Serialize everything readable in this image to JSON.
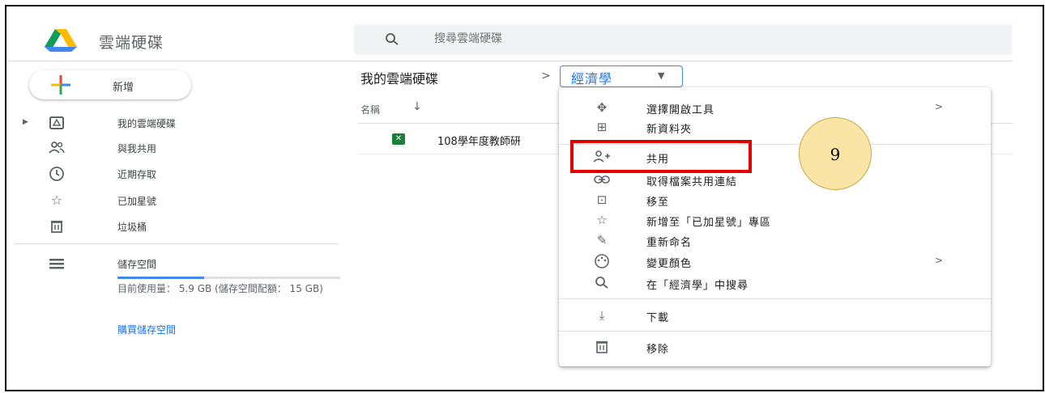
{
  "header": {
    "app_title": "雲端硬碟",
    "search_placeholder": "搜尋雲端硬碟"
  },
  "new_button": {
    "label": "新增"
  },
  "sidebar": {
    "items": [
      {
        "label": "我的雲端硬碟",
        "icon": "drive-icon"
      },
      {
        "label": "與我共用",
        "icon": "shared-people-icon"
      },
      {
        "label": "近期存取",
        "icon": "clock-icon"
      },
      {
        "label": "已加星號",
        "icon": "star-icon"
      },
      {
        "label": "垃圾桶",
        "icon": "trash-icon"
      }
    ],
    "storage": {
      "label": "儲存空間",
      "usage_text": "目前使用量： 5.9 GB (儲存空間配額： 15 GB)",
      "usage_fraction": 0.39,
      "buy_link": "購買儲存空間"
    }
  },
  "breadcrumb": {
    "root": "我的雲端硬碟",
    "separator": ">",
    "current": "經濟學"
  },
  "file_list": {
    "column_name": "名稱",
    "sort_direction": "↓",
    "files": [
      {
        "name": "108學年度教師研",
        "type": "sheet-icon"
      }
    ]
  },
  "context_menu": {
    "items": [
      {
        "label": "選擇開啟工具",
        "icon": "open-with-icon",
        "has_submenu": true
      },
      {
        "label": "新資料夾",
        "icon": "new-folder-icon",
        "has_submenu": false
      },
      {
        "label": "共用",
        "icon": "share-person-icon",
        "has_submenu": false
      },
      {
        "label": "取得檔案共用連結",
        "icon": "link-icon",
        "has_submenu": false
      },
      {
        "label": "移至",
        "icon": "move-to-icon",
        "has_submenu": false
      },
      {
        "label": "新增至「已加星號」專區",
        "icon": "star-icon",
        "has_submenu": false
      },
      {
        "label": "重新命名",
        "icon": "pencil-icon",
        "has_submenu": false
      },
      {
        "label": "變更顏色",
        "icon": "palette-icon",
        "has_submenu": true
      },
      {
        "label": "在「經濟學」中搜尋",
        "icon": "search-icon",
        "has_submenu": false
      },
      {
        "label": "下載",
        "icon": "download-icon",
        "has_submenu": false
      },
      {
        "label": "移除",
        "icon": "trash-icon",
        "has_submenu": false
      }
    ],
    "submenu_chevron": ">"
  },
  "annotation": {
    "step_number": "9"
  },
  "colors": {
    "accent": "#1a73e8",
    "highlight": "#e30000",
    "badge_fill": "#fbe5a6",
    "sheet_green": "#188038"
  }
}
